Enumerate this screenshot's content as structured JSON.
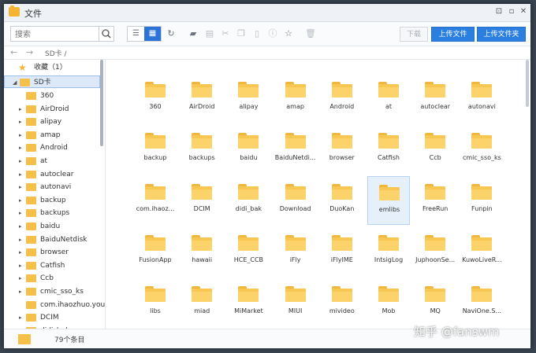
{
  "window": {
    "title": "文件"
  },
  "toolbar": {
    "search_placeholder": "搜索",
    "download_label": "下载",
    "upload_file_label": "上传文件",
    "upload_folder_label": "上传文件夹"
  },
  "breadcrumb": {
    "path": "SD卡 /"
  },
  "sidebar": {
    "favorites_label": "收藏（1）",
    "root_label": "SD卡",
    "items": [
      "360",
      "AirDroid",
      "alipay",
      "amap",
      "Android",
      "at",
      "autoclear",
      "autonavi",
      "backup",
      "backups",
      "baidu",
      "BaiduNetdisk",
      "browser",
      "Catfish",
      "Ccb",
      "cmic_sso_ks",
      "com.ihaozhuo.you...",
      "DCIM",
      "didi_bak"
    ]
  },
  "grid": {
    "folders": [
      "360",
      "AirDroid",
      "alipay",
      "amap",
      "Android",
      "at",
      "autoclear",
      "autonavi",
      "backup",
      "backups",
      "baidu",
      "BaiduNetdi...",
      "browser",
      "Catfish",
      "Ccb",
      "cmic_sso_ks",
      "com.ihaoz...",
      "DCIM",
      "didi_bak",
      "Download",
      "DuoKan",
      "emlibs",
      "FreeRun",
      "Funpin",
      "FusionApp",
      "hawaii",
      "HCE_CCB",
      "iFly",
      "iFlyIME",
      "IntsigLog",
      "JuphoonSe...",
      "KuwoLiveR...",
      "libs",
      "miad",
      "MiMarket",
      "MIUI",
      "mivideo",
      "Mob",
      "MQ",
      "NaviOne.S..."
    ]
  },
  "status": {
    "count_text": "79个条目"
  },
  "watermark": {
    "text": "知乎 @fanswm"
  }
}
